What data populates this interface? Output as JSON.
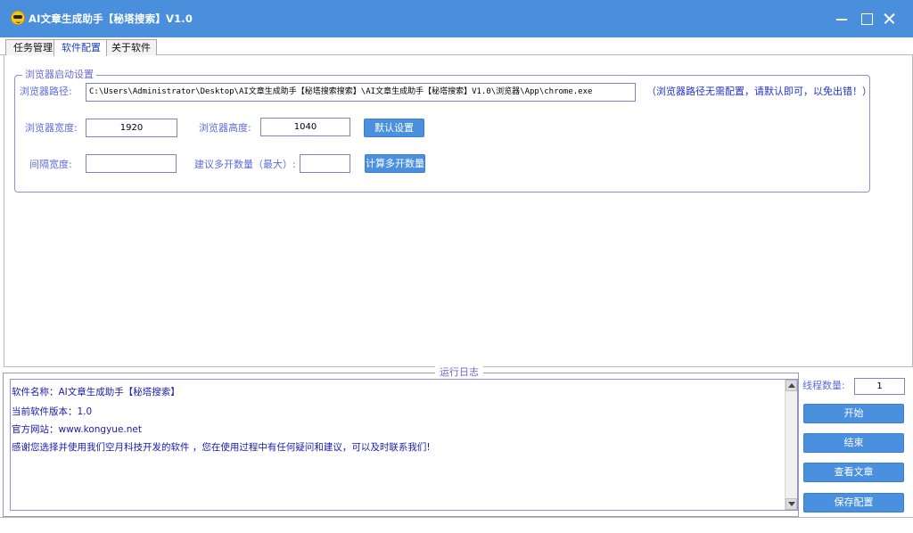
{
  "window": {
    "title": "AI文章生成助手【秘塔搜索】V1.0"
  },
  "tabs": [
    {
      "label": "任务管理"
    },
    {
      "label": "软件配置"
    },
    {
      "label": "关于软件"
    }
  ],
  "browser_settings": {
    "group_title": "浏览器启动设置",
    "path_label": "浏览器路径:",
    "path_value": "C:\\Users\\Administrator\\Desktop\\AI文章生成助手【秘塔搜索搜索】\\AI文章生成助手【秘塔搜索】V1.0\\浏览器\\App\\chrome.exe",
    "path_hint": "（浏览器路径无需配置，请默认即可，以免出错！）",
    "width_label": "浏览器宽度:",
    "width_value": "1920",
    "height_label": "浏览器高度:",
    "height_value": "1040",
    "default_button": "默认设置",
    "gap_label": "间隔宽度:",
    "gap_value": "",
    "suggest_label": "建议多开数量（最大）:",
    "suggest_value": "",
    "calc_button": "计算多开数量"
  },
  "log": {
    "title": "运行日志",
    "lines": [
      "软件名称：AI文章生成助手【秘塔搜索】",
      "当前软件版本：1.0",
      "官方网站：www.kongyue.net",
      "感谢您选择并使用我们空月科技开发的软件 ，您在使用过程中有任何疑问和建议，可以及时联系我们!"
    ]
  },
  "controls": {
    "thread_label": "线程数量:",
    "thread_value": "1",
    "start_button": "开始",
    "stop_button": "结束",
    "view_button": "查看文章",
    "save_button": "保存配置"
  }
}
